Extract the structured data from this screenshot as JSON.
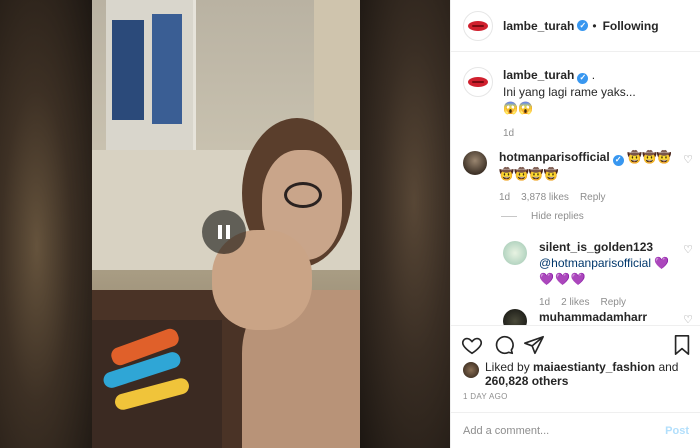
{
  "header": {
    "username": "lambe_turah",
    "verified_icon": "verified-badge-icon",
    "separator": "•",
    "follow_label": "Following"
  },
  "caption": {
    "username": "lambe_turah",
    "suffix": ".",
    "text": "Ini yang lagi rame yaks...",
    "emojis": "😱😱",
    "time": "1d"
  },
  "comments": [
    {
      "username": "hotmanparisofficial",
      "emojis_inline": "🤠🤠🤠",
      "emojis_line2": "🤠🤠🤠🤠",
      "time": "1d",
      "likes": "3,878 likes",
      "reply_label": "Reply"
    }
  ],
  "hide_replies_label": "Hide replies",
  "replies": [
    {
      "username": "silent_is_golden123",
      "mention": "@hotmanparisofficial",
      "hearts_inline": "💜",
      "hearts_line2": "💜💜💜",
      "time": "1d",
      "likes": "2 likes",
      "reply_label": "Reply"
    },
    {
      "username": "muhammadamharr"
    }
  ],
  "likes": {
    "prefix": "Liked by",
    "user": "maiaestianty_fashion",
    "and": "and",
    "count": "260,828 others"
  },
  "date_label": "1 DAY AGO",
  "add_comment": {
    "placeholder": "Add a comment...",
    "post_label": "Post"
  },
  "colors": {
    "accent_blue": "#3897f0",
    "post_disabled": "#b2dffc",
    "muted_text": "#8e8e8e"
  }
}
